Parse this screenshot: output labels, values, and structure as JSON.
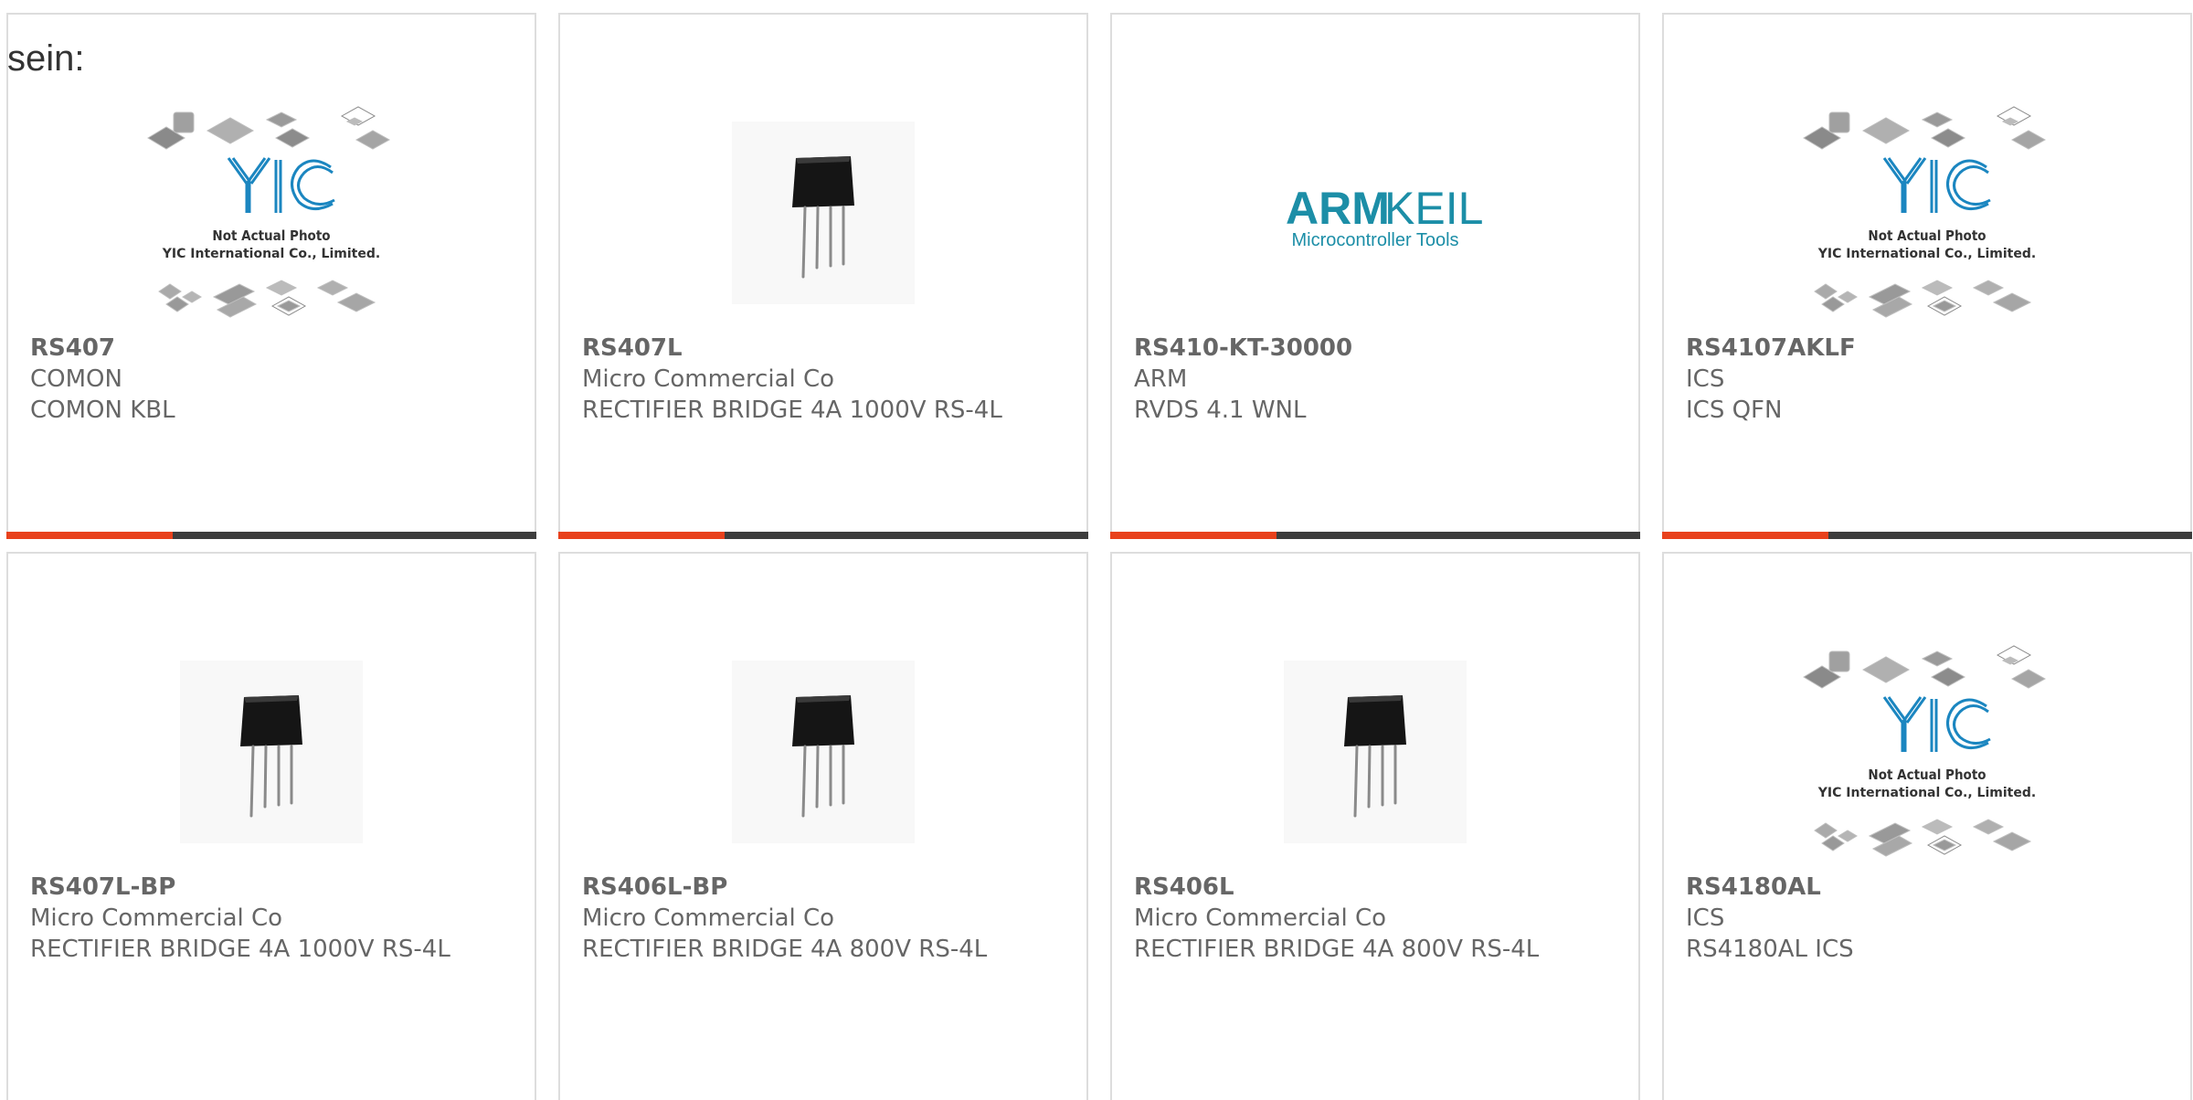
{
  "heading": "sein:",
  "colors": {
    "accent": "#e8411c",
    "bar": "#3d3d3d",
    "yic_blue": "#1b86c0",
    "arm_teal": "#1c8ea7"
  },
  "placeholder": {
    "logo_text": "YIC",
    "line1": "Not Actual Photo",
    "line2": "YIC International Co., Limited."
  },
  "arm_logo": {
    "arm": "ARM",
    "keil": "KEIL",
    "sub": "Microcontroller Tools"
  },
  "products": [
    {
      "part": "RS407",
      "maker": "COMON",
      "desc": "COMON KBL",
      "image": "yic-placeholder"
    },
    {
      "part": "RS407L",
      "maker": "Micro Commercial Co",
      "desc": "RECTIFIER BRIDGE 4A 1000V RS-4L",
      "image": "bridge-rectifier"
    },
    {
      "part": "RS410-KT-30000",
      "maker": "ARM",
      "desc": "RVDS 4.1 WNL",
      "image": "arm-keil-logo"
    },
    {
      "part": "RS4107AKLF",
      "maker": "ICS",
      "desc": "ICS QFN",
      "image": "yic-placeholder"
    },
    {
      "part": "RS407L-BP",
      "maker": "Micro Commercial Co",
      "desc": "RECTIFIER BRIDGE 4A 1000V RS-4L",
      "image": "bridge-rectifier"
    },
    {
      "part": "RS406L-BP",
      "maker": "Micro Commercial Co",
      "desc": "RECTIFIER BRIDGE 4A 800V RS-4L",
      "image": "bridge-rectifier"
    },
    {
      "part": "RS406L",
      "maker": "Micro Commercial Co",
      "desc": "RECTIFIER BRIDGE 4A 800V RS-4L",
      "image": "bridge-rectifier"
    },
    {
      "part": "RS4180AL",
      "maker": "ICS",
      "desc": "RS4180AL ICS",
      "image": "yic-placeholder"
    }
  ]
}
